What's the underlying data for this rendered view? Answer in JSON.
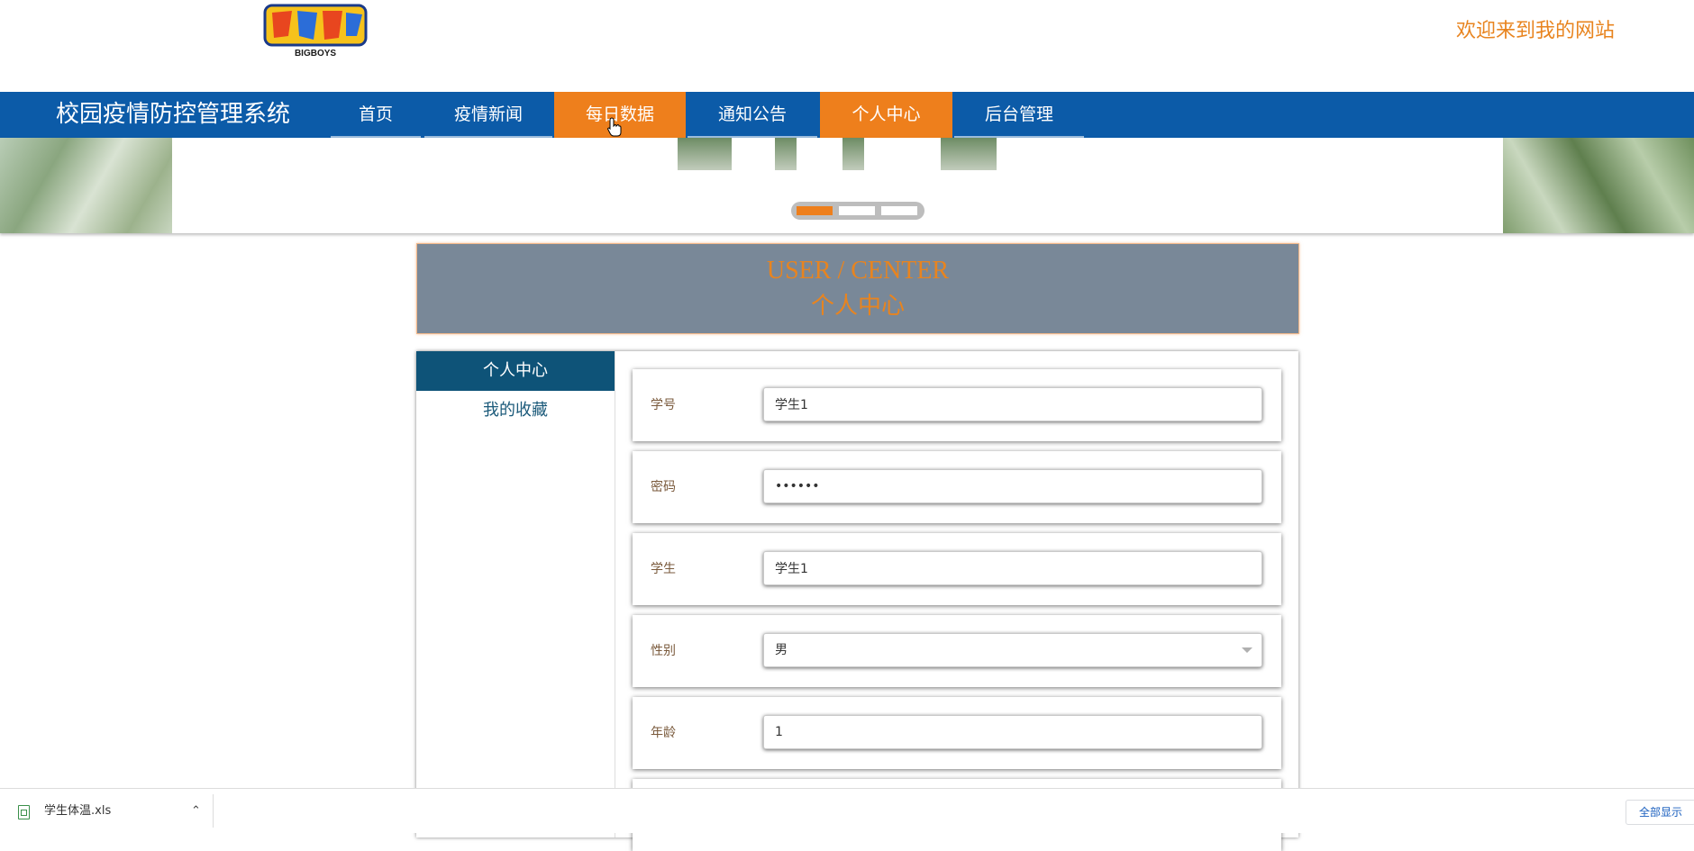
{
  "header": {
    "welcome": "欢迎来到我的网站",
    "logo_text": "BIGBOYS"
  },
  "nav": {
    "site_title": "校园疫情防控管理系统",
    "items": [
      {
        "label": "首页",
        "active": false
      },
      {
        "label": "疫情新闻",
        "active": false
      },
      {
        "label": "每日数据",
        "active": true
      },
      {
        "label": "通知公告",
        "active": false
      },
      {
        "label": "个人中心",
        "active": true
      },
      {
        "label": "后台管理",
        "active": false
      }
    ]
  },
  "banner": {
    "slides": 3,
    "active_slide": 1
  },
  "user_center": {
    "title_en": "USER / CENTER",
    "title_cn": "个人中心"
  },
  "sidebar": {
    "items": [
      {
        "label": "个人中心",
        "active": true
      },
      {
        "label": "我的收藏",
        "active": false
      }
    ]
  },
  "form": {
    "student_id": {
      "label": "学号",
      "value": "学生1"
    },
    "password": {
      "label": "密码",
      "value": "••••••"
    },
    "student_name": {
      "label": "学生",
      "value": "学生1"
    },
    "gender": {
      "label": "性别",
      "value": "男"
    },
    "age": {
      "label": "年龄",
      "value": "1"
    }
  },
  "download_bar": {
    "file_name": "学生体温.xls",
    "show_all": "全部显示"
  },
  "colors": {
    "nav_bg": "#0c5ba8",
    "accent": "#ee7f1c",
    "sidebar_active": "#0e5378",
    "uc_box": "#798898"
  }
}
